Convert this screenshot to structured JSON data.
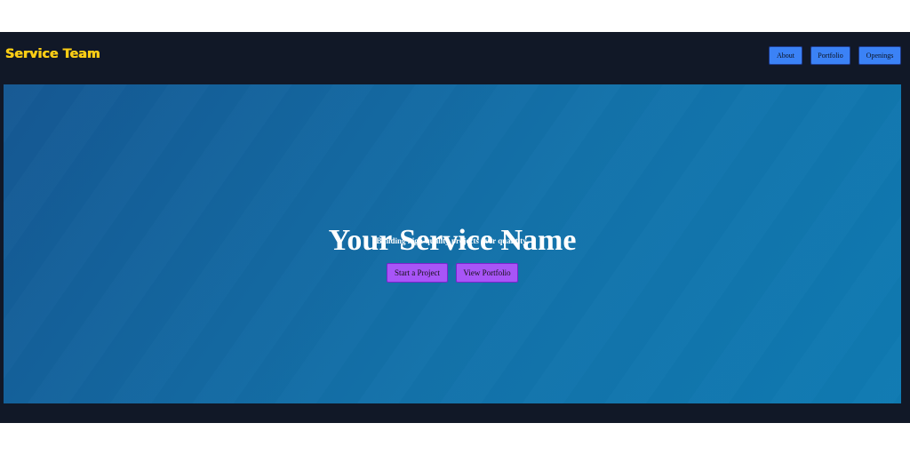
{
  "header": {
    "logo_text": "Service Team",
    "nav": [
      {
        "label": "About"
      },
      {
        "label": "Portfolio"
      },
      {
        "label": "Openings"
      }
    ]
  },
  "hero": {
    "title": "Your Service Name",
    "subtitle": "Building high-quality projects over quantity.",
    "buttons": [
      {
        "label": "Start a Project"
      },
      {
        "label": "View Portfolio"
      }
    ]
  },
  "colors": {
    "page_background": "#111827",
    "logo": "#facc15",
    "nav_button": "#3b82f6",
    "hero_gradient_start": "#155893",
    "hero_gradient_end": "#0f7ab2",
    "cta_button": "#a855f7"
  }
}
